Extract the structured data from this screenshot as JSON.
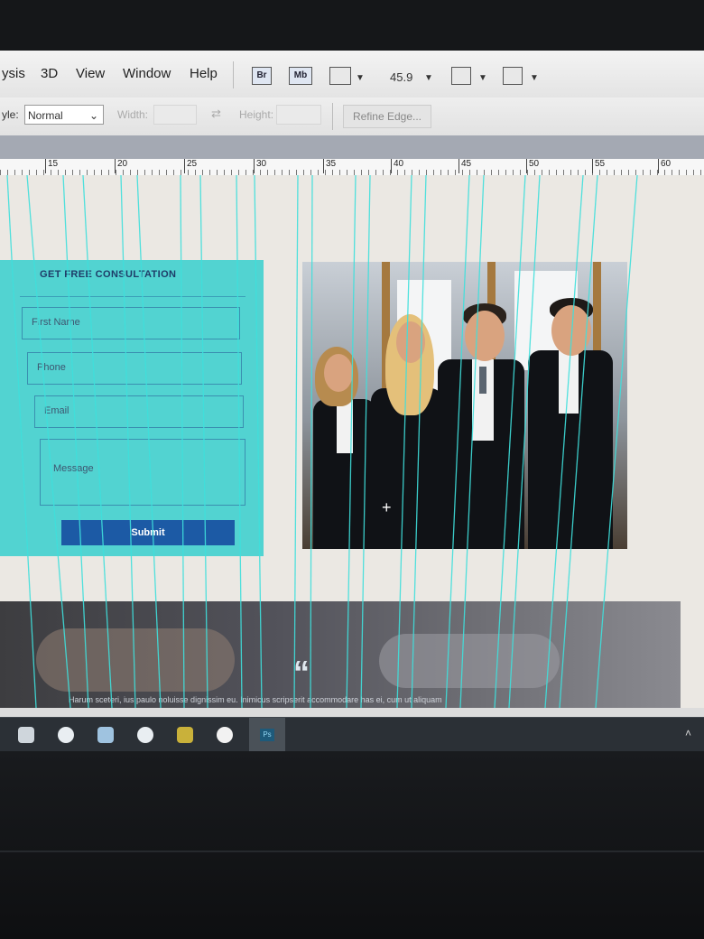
{
  "menubar": {
    "items": [
      "ysis",
      "3D",
      "View",
      "Window",
      "Help"
    ],
    "bridge_label": "Br",
    "minibridge_label": "Mb",
    "zoom": "45.9"
  },
  "options": {
    "style_label": "yle:",
    "style_value": "Normal",
    "width_label": "Width:",
    "height_label": "Height:",
    "refine_label": "Refine Edge..."
  },
  "ruler": {
    "ticks": [
      "15",
      "20",
      "25",
      "30",
      "35",
      "40",
      "45",
      "50",
      "55",
      "60"
    ]
  },
  "form": {
    "title": "GET FREE CONSULTATION",
    "first_name_placeholder": "First Name",
    "phone_placeholder": "Phone",
    "email_placeholder": "Email",
    "message_placeholder": "Message",
    "submit_label": "Submit",
    "panel_color": "#52d3d1",
    "submit_color": "#1c5aa5"
  },
  "testimonial": {
    "quote_mark": "“",
    "text": "Harum sceteri, ius paulo noluisse dignissim eu. Inimicus scripserit accommodare has ei, cum ut aliquam"
  },
  "photo": {
    "subject": "business-team-photo"
  },
  "colors": {
    "guide": "#3fe0dc"
  }
}
